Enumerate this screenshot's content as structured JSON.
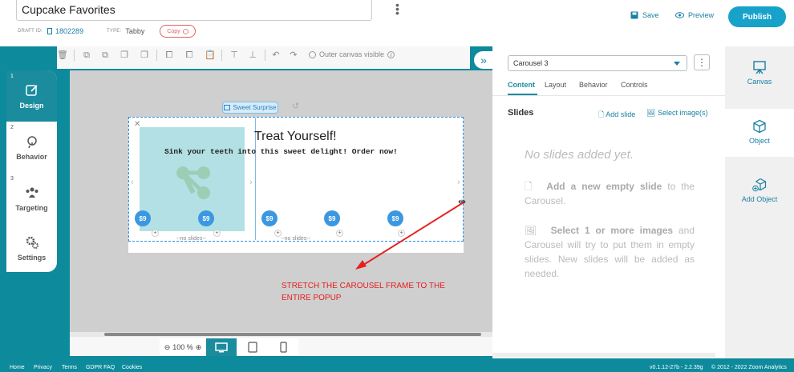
{
  "header": {
    "title": "Cupcake Favorites",
    "draft_id_label": "DRAFT ID:",
    "draft_id": "1802289",
    "type_label": "TYPE:",
    "type": "Tabby",
    "copy_label": "Copy",
    "save_label": "Save",
    "preview_label": "Preview",
    "publish_label": "Publish"
  },
  "left_sidebar": [
    {
      "num": "1",
      "label": "Design",
      "icon": "edit-icon",
      "active": true
    },
    {
      "num": "2",
      "label": "Behavior",
      "icon": "behavior-icon"
    },
    {
      "num": "3",
      "label": "Targeting",
      "icon": "targeting-icon"
    },
    {
      "num": "",
      "label": "Settings",
      "icon": "gears-icon"
    }
  ],
  "toolbar": {
    "outer_canvas_label": "Outer canvas visible"
  },
  "canvas": {
    "chip_label": "Sweet Surprise",
    "popup_title": "Treat Yourself!",
    "popup_subtitle": "Sink your teeth into this sweet delight! Order now!",
    "prices": [
      "$9",
      "$9",
      "$9",
      "$9",
      "$9"
    ],
    "no_slides_label": "--no slides--",
    "annotation": "STRETCH THE CAROUSEL FRAME TO THE ENTIRE POPUP"
  },
  "bottom": {
    "zoom": "100 %"
  },
  "panel": {
    "selected_object": "Carousel 3",
    "tabs": [
      "Content",
      "Layout",
      "Behavior",
      "Controls"
    ],
    "slides_heading": "Slides",
    "add_slide_label": "Add slide",
    "select_images_label": "Select image(s)",
    "empty_title": "No slides added yet.",
    "hint1_bold": "Add a new empty slide",
    "hint1_rest": "to the Carousel.",
    "hint2_bold": "Select 1 or more images",
    "hint2_rest": "and Carousel will try to put them in empty slides. New slides will be added as needed."
  },
  "right_sidebar": [
    {
      "label": "Canvas",
      "icon": "easel-icon"
    },
    {
      "label": "Object",
      "icon": "cube-icon",
      "active": true
    },
    {
      "label": "Add Object",
      "icon": "add-cube-icon"
    }
  ],
  "footer": {
    "links": [
      "Home",
      "Privacy",
      "Terms",
      "GDPR FAQ",
      "Cookies"
    ],
    "version": "v0.1.12-27b - 2.2.39g",
    "copyright": "© 2012 - 2022 Zoom Analytics"
  },
  "colors": {
    "teal": "#1b8c9e",
    "accent": "#17a2c9",
    "annotation_red": "#e52020"
  }
}
